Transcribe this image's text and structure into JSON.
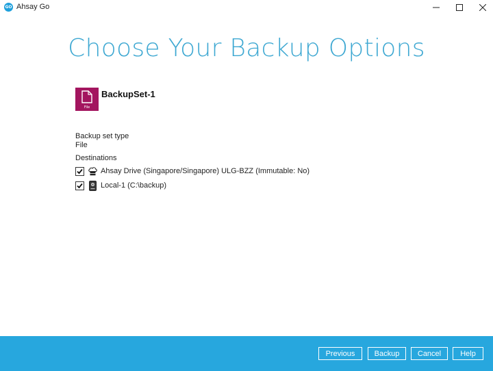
{
  "window": {
    "title": "Ahsay Go",
    "logo_text": "GO",
    "controls": [
      "minimize-icon",
      "maximize-icon",
      "close-icon"
    ]
  },
  "page": {
    "heading": "Choose Your Backup Options"
  },
  "backup_set": {
    "name": "BackupSet-1",
    "icon": "file-icon",
    "icon_label": "File",
    "icon_color": "#a3155f"
  },
  "details": {
    "type_label": "Backup set type",
    "type_value": "File",
    "destinations_label": "Destinations",
    "destinations": [
      {
        "label": "Ahsay Drive (Singapore/Singapore) ULG-BZZ (Immutable: No)",
        "checked": true,
        "icon": "cloud-drive-icon"
      },
      {
        "label": "Local-1 (C:\\backup)",
        "checked": true,
        "icon": "local-drive-icon"
      }
    ]
  },
  "footer": {
    "background": "#27a7de",
    "previous": "Previous",
    "backup": "Backup",
    "cancel": "Cancel",
    "help": "Help"
  },
  "colors": {
    "heading": "#3ea8d2",
    "accent": "#27a7de"
  }
}
